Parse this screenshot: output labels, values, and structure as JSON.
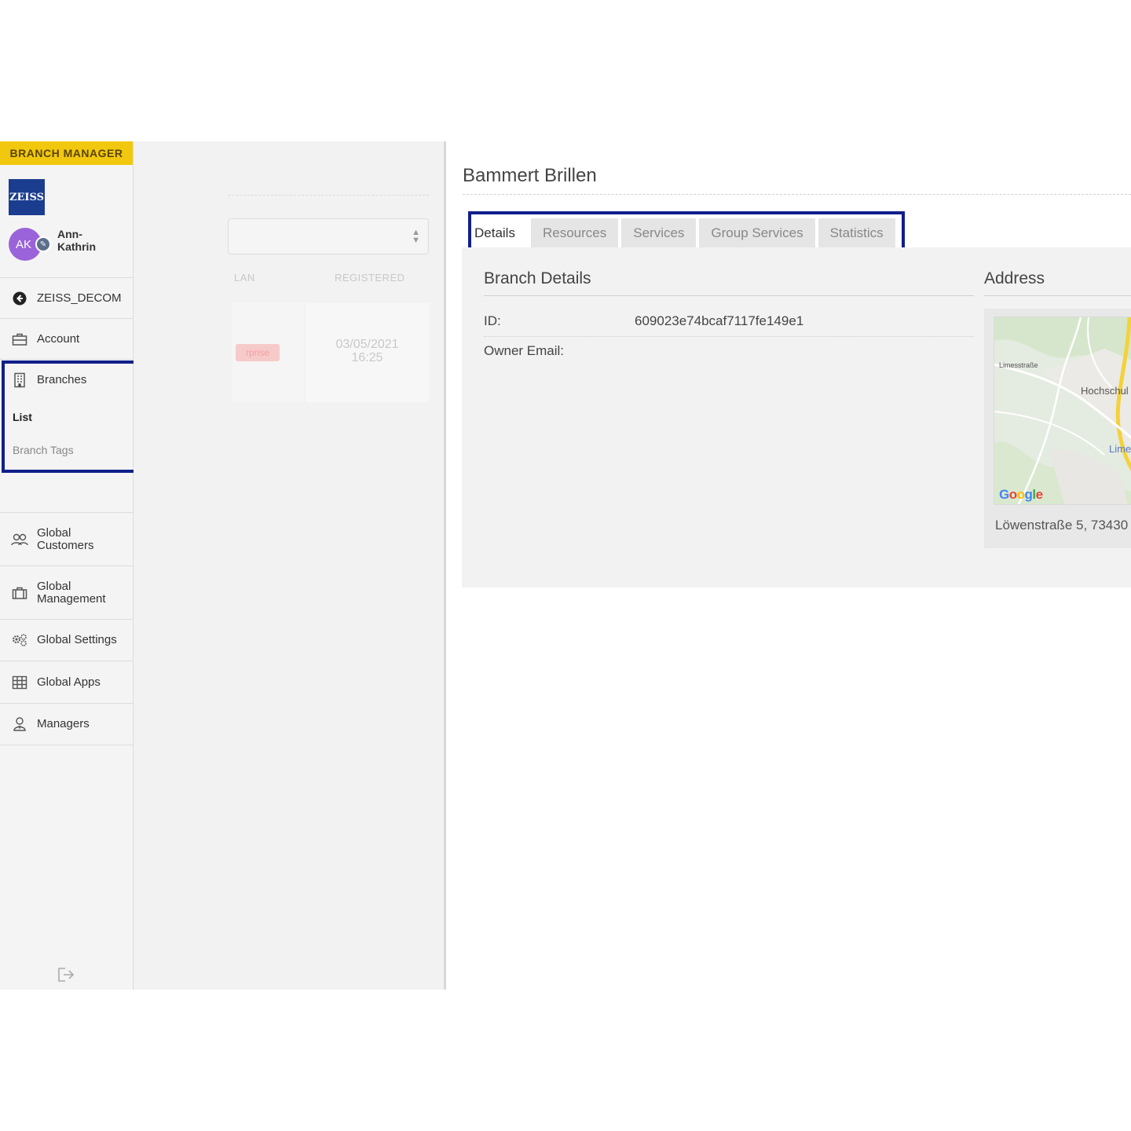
{
  "sidebar": {
    "role_badge": "BRANCH MANAGER",
    "logo_text": "ZEISS",
    "user": {
      "initials": "AK",
      "name": "Ann-\nKathrin"
    },
    "items": [
      {
        "label": "ZEISS_DECOM",
        "icon": "back-arrow-circle-icon"
      },
      {
        "label": "Account",
        "icon": "briefcase-icon"
      },
      {
        "label": "Branches",
        "icon": "building-icon"
      },
      {
        "label": "Global\nCustomers",
        "icon": "users-icon"
      },
      {
        "label": "Global\nManagement",
        "icon": "case-icon"
      },
      {
        "label": "Global Settings",
        "icon": "gears-icon"
      },
      {
        "label": "Global Apps",
        "icon": "grid-icon"
      },
      {
        "label": "Managers",
        "icon": "user-manager-icon"
      }
    ],
    "sub_items": [
      {
        "label": "List",
        "active": true
      },
      {
        "label": "Branch Tags",
        "active": false
      }
    ],
    "highlight_color": "#111f8a",
    "badge_color": "#f2c80f"
  },
  "list_panel": {
    "column_left": "LAN",
    "column_registered": "REGISTERED",
    "tag_text": "rprise",
    "registered_value": "03/05/2021\n16:25"
  },
  "detail": {
    "title": "Bammert Brillen",
    "tabs": [
      "Details",
      "Resources",
      "Services",
      "Group Services",
      "Statistics"
    ],
    "active_tab": "Details",
    "branch_details": {
      "title": "Branch Details",
      "id_label": "ID:",
      "id_value": "609023e74bcaf7117fe149e1",
      "owner_email_label": "Owner Email:",
      "owner_email_value": ""
    },
    "address": {
      "title": "Address",
      "map_labels": [
        "Hochschul",
        "Lime",
        "Limesstraße"
      ],
      "google_label": "Google",
      "text": "Löwenstraße 5, 73430"
    }
  }
}
